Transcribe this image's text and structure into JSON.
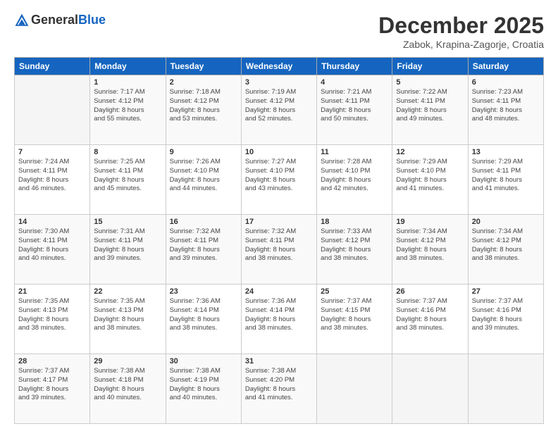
{
  "header": {
    "logo_general": "General",
    "logo_blue": "Blue",
    "month_title": "December 2025",
    "location": "Zabok, Krapina-Zagorje, Croatia"
  },
  "weekdays": [
    "Sunday",
    "Monday",
    "Tuesday",
    "Wednesday",
    "Thursday",
    "Friday",
    "Saturday"
  ],
  "weeks": [
    [
      {
        "day": "",
        "info": ""
      },
      {
        "day": "1",
        "info": "Sunrise: 7:17 AM\nSunset: 4:12 PM\nDaylight: 8 hours\nand 55 minutes."
      },
      {
        "day": "2",
        "info": "Sunrise: 7:18 AM\nSunset: 4:12 PM\nDaylight: 8 hours\nand 53 minutes."
      },
      {
        "day": "3",
        "info": "Sunrise: 7:19 AM\nSunset: 4:12 PM\nDaylight: 8 hours\nand 52 minutes."
      },
      {
        "day": "4",
        "info": "Sunrise: 7:21 AM\nSunset: 4:11 PM\nDaylight: 8 hours\nand 50 minutes."
      },
      {
        "day": "5",
        "info": "Sunrise: 7:22 AM\nSunset: 4:11 PM\nDaylight: 8 hours\nand 49 minutes."
      },
      {
        "day": "6",
        "info": "Sunrise: 7:23 AM\nSunset: 4:11 PM\nDaylight: 8 hours\nand 48 minutes."
      }
    ],
    [
      {
        "day": "7",
        "info": "Sunrise: 7:24 AM\nSunset: 4:11 PM\nDaylight: 8 hours\nand 46 minutes."
      },
      {
        "day": "8",
        "info": "Sunrise: 7:25 AM\nSunset: 4:11 PM\nDaylight: 8 hours\nand 45 minutes."
      },
      {
        "day": "9",
        "info": "Sunrise: 7:26 AM\nSunset: 4:10 PM\nDaylight: 8 hours\nand 44 minutes."
      },
      {
        "day": "10",
        "info": "Sunrise: 7:27 AM\nSunset: 4:10 PM\nDaylight: 8 hours\nand 43 minutes."
      },
      {
        "day": "11",
        "info": "Sunrise: 7:28 AM\nSunset: 4:10 PM\nDaylight: 8 hours\nand 42 minutes."
      },
      {
        "day": "12",
        "info": "Sunrise: 7:29 AM\nSunset: 4:10 PM\nDaylight: 8 hours\nand 41 minutes."
      },
      {
        "day": "13",
        "info": "Sunrise: 7:29 AM\nSunset: 4:11 PM\nDaylight: 8 hours\nand 41 minutes."
      }
    ],
    [
      {
        "day": "14",
        "info": "Sunrise: 7:30 AM\nSunset: 4:11 PM\nDaylight: 8 hours\nand 40 minutes."
      },
      {
        "day": "15",
        "info": "Sunrise: 7:31 AM\nSunset: 4:11 PM\nDaylight: 8 hours\nand 39 minutes."
      },
      {
        "day": "16",
        "info": "Sunrise: 7:32 AM\nSunset: 4:11 PM\nDaylight: 8 hours\nand 39 minutes."
      },
      {
        "day": "17",
        "info": "Sunrise: 7:32 AM\nSunset: 4:11 PM\nDaylight: 8 hours\nand 38 minutes."
      },
      {
        "day": "18",
        "info": "Sunrise: 7:33 AM\nSunset: 4:12 PM\nDaylight: 8 hours\nand 38 minutes."
      },
      {
        "day": "19",
        "info": "Sunrise: 7:34 AM\nSunset: 4:12 PM\nDaylight: 8 hours\nand 38 minutes."
      },
      {
        "day": "20",
        "info": "Sunrise: 7:34 AM\nSunset: 4:12 PM\nDaylight: 8 hours\nand 38 minutes."
      }
    ],
    [
      {
        "day": "21",
        "info": "Sunrise: 7:35 AM\nSunset: 4:13 PM\nDaylight: 8 hours\nand 38 minutes."
      },
      {
        "day": "22",
        "info": "Sunrise: 7:35 AM\nSunset: 4:13 PM\nDaylight: 8 hours\nand 38 minutes."
      },
      {
        "day": "23",
        "info": "Sunrise: 7:36 AM\nSunset: 4:14 PM\nDaylight: 8 hours\nand 38 minutes."
      },
      {
        "day": "24",
        "info": "Sunrise: 7:36 AM\nSunset: 4:14 PM\nDaylight: 8 hours\nand 38 minutes."
      },
      {
        "day": "25",
        "info": "Sunrise: 7:37 AM\nSunset: 4:15 PM\nDaylight: 8 hours\nand 38 minutes."
      },
      {
        "day": "26",
        "info": "Sunrise: 7:37 AM\nSunset: 4:16 PM\nDaylight: 8 hours\nand 38 minutes."
      },
      {
        "day": "27",
        "info": "Sunrise: 7:37 AM\nSunset: 4:16 PM\nDaylight: 8 hours\nand 39 minutes."
      }
    ],
    [
      {
        "day": "28",
        "info": "Sunrise: 7:37 AM\nSunset: 4:17 PM\nDaylight: 8 hours\nand 39 minutes."
      },
      {
        "day": "29",
        "info": "Sunrise: 7:38 AM\nSunset: 4:18 PM\nDaylight: 8 hours\nand 40 minutes."
      },
      {
        "day": "30",
        "info": "Sunrise: 7:38 AM\nSunset: 4:19 PM\nDaylight: 8 hours\nand 40 minutes."
      },
      {
        "day": "31",
        "info": "Sunrise: 7:38 AM\nSunset: 4:20 PM\nDaylight: 8 hours\nand 41 minutes."
      },
      {
        "day": "",
        "info": ""
      },
      {
        "day": "",
        "info": ""
      },
      {
        "day": "",
        "info": ""
      }
    ]
  ]
}
